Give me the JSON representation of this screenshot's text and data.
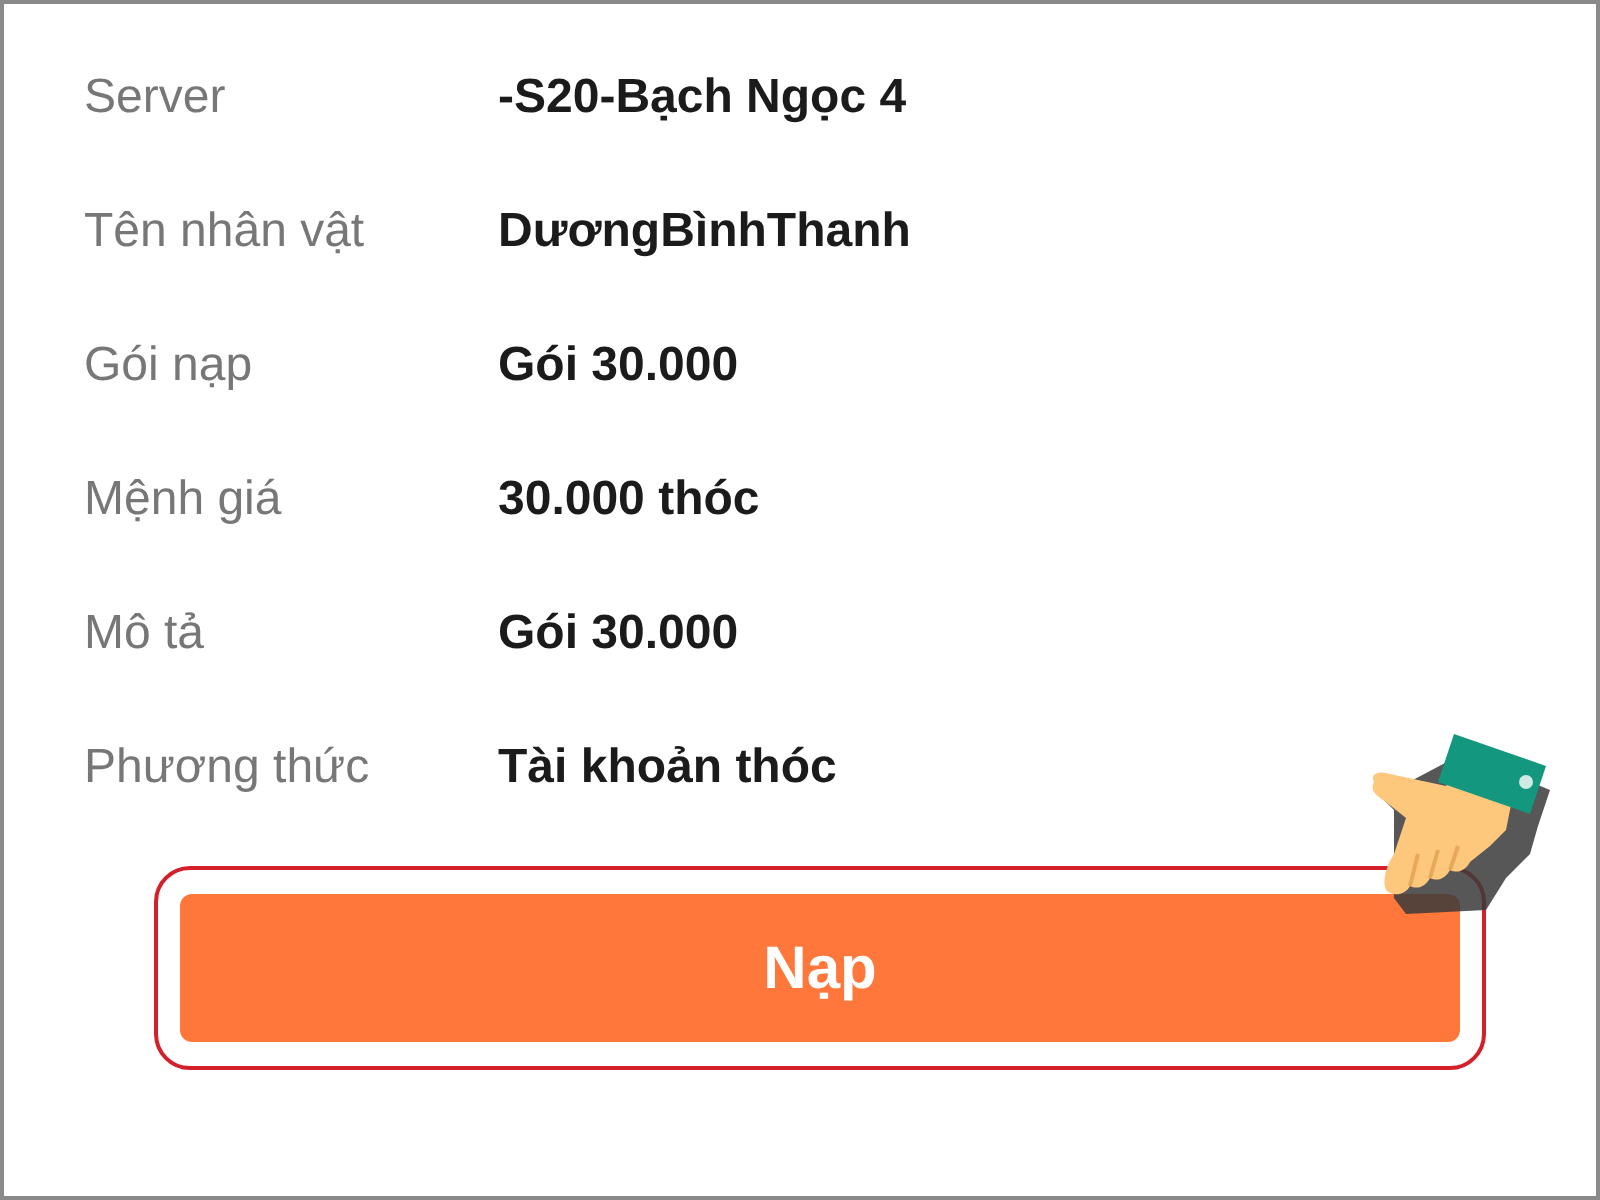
{
  "details": [
    {
      "label": "Server",
      "value": "-S20-Bạch Ngọc 4"
    },
    {
      "label": "Tên nhân vật",
      "value": "DươngBìnhThanh"
    },
    {
      "label": "Gói nạp",
      "value": "Gói 30.000"
    },
    {
      "label": "Mệnh giá",
      "value": "30.000 thóc"
    },
    {
      "label": "Mô tả",
      "value": "Gói 30.000"
    },
    {
      "label": "Phương thức",
      "value": "Tài khoản thóc"
    }
  ],
  "submit_button": {
    "label": "Nạp",
    "highlighted": true
  }
}
